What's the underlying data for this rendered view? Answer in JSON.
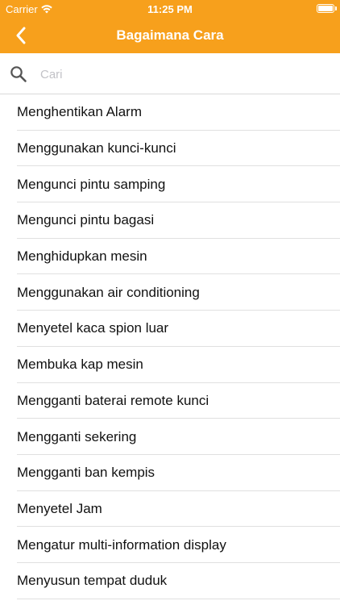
{
  "status_bar": {
    "carrier": "Carrier",
    "time": "11:25 PM"
  },
  "navbar": {
    "title": "Bagaimana Cara",
    "back_icon": "chevron-left-icon"
  },
  "search": {
    "placeholder": "Cari",
    "value": ""
  },
  "colors": {
    "accent": "#f7a01c",
    "text": "#111111",
    "separator": "#e0e0e0"
  },
  "items": [
    {
      "label": "Menghentikan Alarm"
    },
    {
      "label": "Menggunakan kunci-kunci"
    },
    {
      "label": "Mengunci pintu samping"
    },
    {
      "label": "Mengunci pintu bagasi"
    },
    {
      "label": "Menghidupkan mesin"
    },
    {
      "label": "Menggunakan air conditioning"
    },
    {
      "label": "Menyetel kaca spion luar"
    },
    {
      "label": "Membuka kap mesin"
    },
    {
      "label": "Mengganti baterai remote kunci"
    },
    {
      "label": "Mengganti sekering"
    },
    {
      "label": "Mengganti ban kempis"
    },
    {
      "label": "Menyetel Jam"
    },
    {
      "label": "Mengatur multi-information display"
    },
    {
      "label": "Menyusun tempat duduk"
    }
  ]
}
